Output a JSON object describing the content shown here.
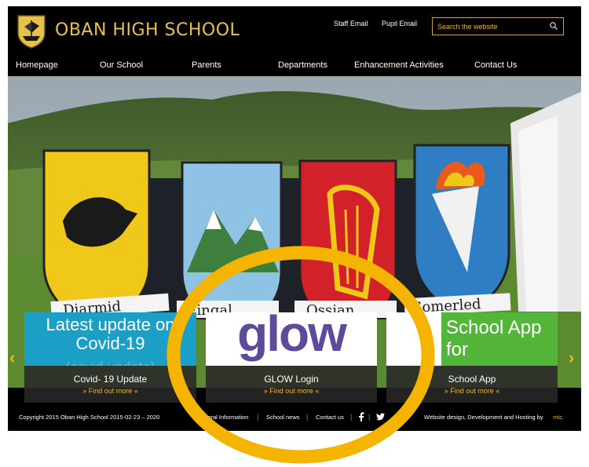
{
  "header": {
    "school_name": "OBAN HIGH SCHOOL",
    "staff_email": "Staff Email",
    "pupil_email": "Pupil Email",
    "search_placeholder": "Search the website"
  },
  "nav": {
    "items": [
      "Homepage",
      "Our School",
      "Parents",
      "Departments",
      "Enhancement Activities",
      "Contact Us"
    ]
  },
  "hero": {
    "banner_texts": [
      "Diarmid",
      "Fingal",
      "Ossian",
      "Somerled"
    ]
  },
  "tiles": [
    {
      "art_text": "Latest update on Covid-19",
      "faint_text": "(covid update)",
      "title": "Covid- 19 Update",
      "more": "» Find out more «"
    },
    {
      "art_text": "glow",
      "title": "GLOW Login",
      "more": "» Find out more «"
    },
    {
      "art_text": "School App for",
      "title": "School App",
      "more": "» Find out more «"
    }
  ],
  "arrows": {
    "prev": "‹",
    "next": "›"
  },
  "footer": {
    "copyright": "Copyright 2015 Oban High School 2015-02-23 – 2020",
    "links": [
      "eneral Information",
      "School news",
      "Contact us"
    ],
    "credit": "Website design, Development and Hosting by",
    "credit_brand": "mtc."
  },
  "colors": {
    "gold": "#e8c14a",
    "accent": "#f0b520",
    "highlight_ring": "#f5b400",
    "covid_tile": "#1b9fc6",
    "app_tile": "#53b53a",
    "glow_purple": "#5e4a9a"
  },
  "icons": [
    "school-crest-icon",
    "search-icon",
    "facebook-icon",
    "twitter-icon",
    "chevron-left-icon",
    "chevron-right-icon"
  ]
}
